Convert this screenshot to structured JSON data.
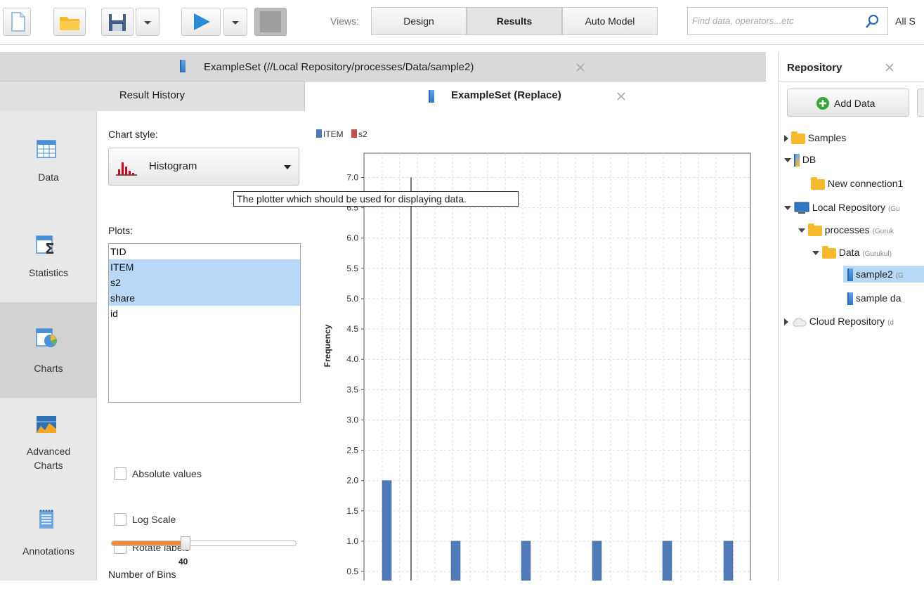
{
  "toolbar": {
    "views_label": "Views:",
    "views": [
      "Design",
      "Results",
      "Auto Model"
    ],
    "active_view": "Results",
    "search_placeholder": "Find data, operators...etc",
    "all_studio_label": "All S"
  },
  "main": {
    "window_tab": "ExampleSet (//Local Repository/processes/Data/sample2)",
    "result_history_tab": "Result History",
    "active_tab": "ExampleSet (Replace)"
  },
  "sidebar": {
    "items": [
      {
        "label": "Data",
        "icon": "table-icon"
      },
      {
        "label": "Statistics",
        "icon": "statistics-icon"
      },
      {
        "label": "Charts",
        "icon": "charts-icon"
      },
      {
        "label": "Advanced\nCharts",
        "icon": "advanced-charts-icon"
      },
      {
        "label": "Annotations",
        "icon": "annotations-icon"
      }
    ],
    "active": "Charts"
  },
  "controls": {
    "chart_style_label": "Chart style:",
    "chart_style_value": "Histogram",
    "tooltip": "The plotter which should be used for displaying data.",
    "plots_label": "Plots:",
    "plots": [
      {
        "name": "TID",
        "selected": false
      },
      {
        "name": "ITEM",
        "selected": true
      },
      {
        "name": "s2",
        "selected": true
      },
      {
        "name": "share",
        "selected": true
      },
      {
        "name": "id",
        "selected": false
      }
    ],
    "absolute_values_label": "Absolute values",
    "log_scale_label": "Log Scale",
    "rotate_labels_label": "Rotate labels",
    "number_of_bins_label": "Number of Bins",
    "number_of_bins_value": "40",
    "bins_slider_fraction": 0.4
  },
  "colors": {
    "item_series": "#4f7bb8",
    "s2_series": "#c0504d",
    "selection": "#b8d8f8",
    "slider_fill": "#f08a3c"
  },
  "chart_data": {
    "type": "bar",
    "legend": [
      "ITEM",
      "s2"
    ],
    "ylabel": "Frequency",
    "ylim": [
      0.35,
      7.4
    ],
    "yticks": [
      "0.5",
      "1.0",
      "1.5",
      "2.0",
      "2.5",
      "3.0",
      "3.5",
      "4.0",
      "4.5",
      "5.0",
      "5.5",
      "6.0",
      "6.5",
      "7.0"
    ],
    "series": [
      {
        "name": "ITEM",
        "values": [
          2,
          1,
          1,
          1,
          1,
          1
        ]
      },
      {
        "name": "s2",
        "values": [
          7
        ]
      }
    ]
  },
  "repository": {
    "title": "Repository",
    "add_data_label": "Add Data",
    "tree": [
      {
        "label": "Samples",
        "sub": ""
      },
      {
        "label": "DB",
        "sub": ""
      },
      {
        "label": "New connection1",
        "sub": ""
      },
      {
        "label": "Local Repository",
        "sub": "(Gu"
      },
      {
        "label": "processes",
        "sub": "(Guruk"
      },
      {
        "label": "Data",
        "sub": "(Gurukul)"
      },
      {
        "label": "sample2",
        "sub": "(G"
      },
      {
        "label": "sample da",
        "sub": ""
      },
      {
        "label": "Cloud Repository",
        "sub": "(d"
      }
    ]
  }
}
